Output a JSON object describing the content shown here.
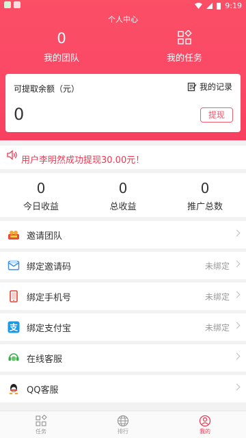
{
  "status_bar": {
    "time": "9:19"
  },
  "header": {
    "title": "个人中心",
    "team": {
      "count": "0",
      "label": "我的团队"
    },
    "tasks": {
      "label": "我的任务",
      "icon": "task-grid-icon"
    }
  },
  "balance_card": {
    "label": "可提取余额（元）",
    "records_label": "我的记录",
    "amount": "0",
    "withdraw_label": "提现"
  },
  "notice": {
    "text": "用户李明然成功提现30.00元！",
    "icon": "speaker-icon"
  },
  "stats": [
    {
      "value": "0",
      "label": "今日收益"
    },
    {
      "value": "0",
      "label": "总收益"
    },
    {
      "value": "0",
      "label": "推广总数"
    }
  ],
  "menu": [
    {
      "label": "邀请团队",
      "value": "",
      "icon": "team-icon"
    },
    {
      "label": "绑定邀请码",
      "value": "未绑定",
      "icon": "invite-code-icon"
    },
    {
      "label": "绑定手机号",
      "value": "未绑定",
      "icon": "phone-icon"
    },
    {
      "label": "绑定支付宝",
      "value": "未绑定",
      "icon": "alipay-icon"
    },
    {
      "label": "在线客服",
      "value": "",
      "icon": "service-icon"
    },
    {
      "label": "QQ客服",
      "value": "",
      "icon": "qq-icon"
    }
  ],
  "tabbar": [
    {
      "label": "任务",
      "icon": "task-grid-icon",
      "active": false
    },
    {
      "label": "排行",
      "icon": "globe-icon",
      "active": false
    },
    {
      "label": "我的",
      "icon": "user-icon",
      "active": true
    }
  ],
  "colors": {
    "accent": "#fb4866",
    "notice": "#f0364f",
    "muted": "#999999"
  }
}
